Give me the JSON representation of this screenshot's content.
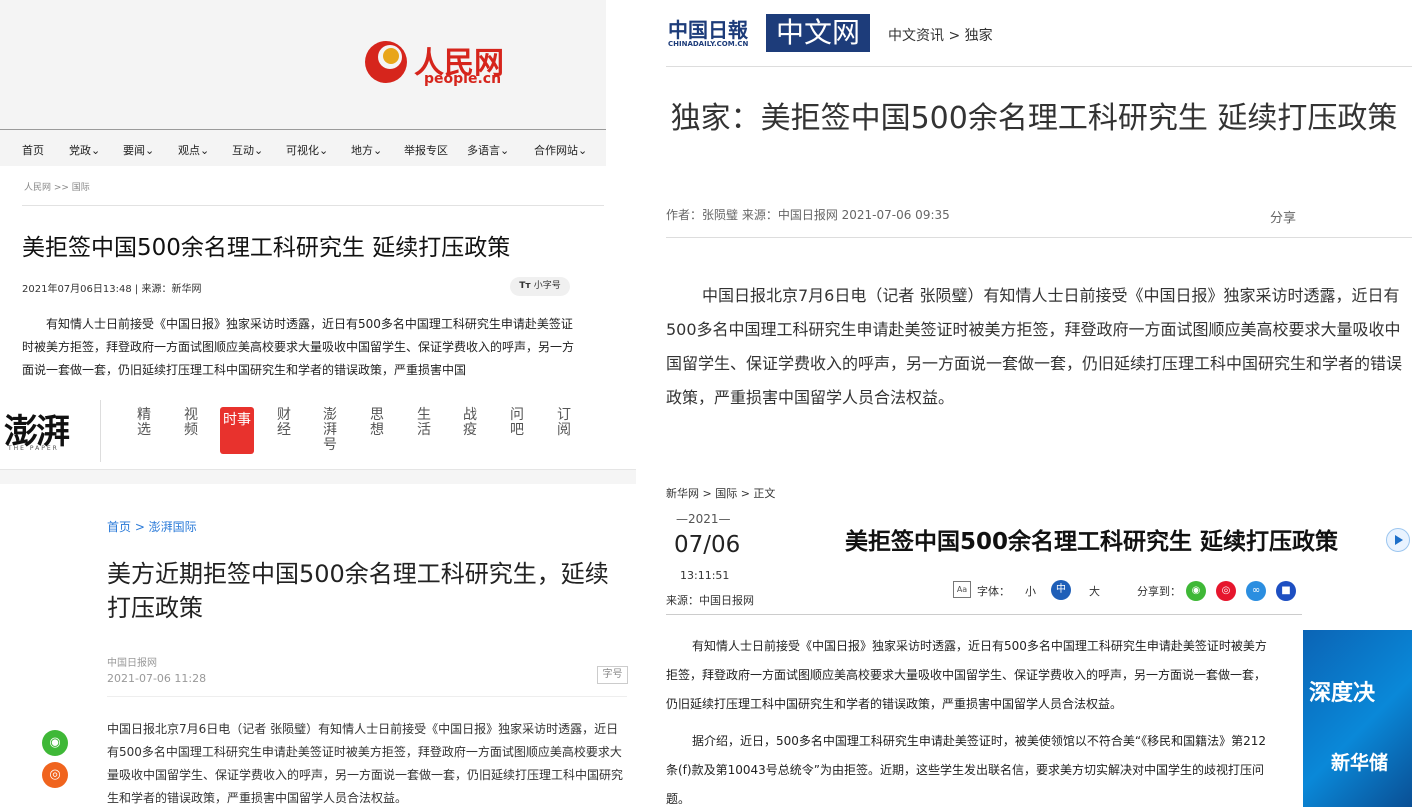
{
  "people": {
    "logo_text": "人民网",
    "logo_url_text": "people.cn",
    "nav": [
      "首页",
      "党政",
      "要闻",
      "观点",
      "互动",
      "可视化",
      "地方",
      "举报专区",
      "多语言",
      "合作网站"
    ],
    "breadcrumb": "人民网 >> 国际",
    "title": "美拒签中国500余名理工科研究生 延续打压政策",
    "meta": "2021年07月06日13:48 | 来源：新华网",
    "font_button": "小字号",
    "body": "有知情人士日前接受《中国日报》独家采访时透露，近日有500多名中国理工科研究生申请赴美签证时被美方拒签，拜登政府一方面试图顺应美高校要求大量吸收中国留学生、保证学费收入的呼声，另一方面说一套做一套，仍旧延续打压理工科中国研究生和学者的错误政策，严重损害中国"
  },
  "paper": {
    "logo_text": "澎湃",
    "logo_sub": "THE PAPER",
    "nav": [
      "精选",
      "视频",
      "时事",
      "财经",
      "澎湃号",
      "思想",
      "生活",
      "战疫",
      "问吧",
      "订阅"
    ],
    "active_nav": "时事",
    "breadcrumb": "首页 > 澎湃国际",
    "title": "美方近期拒签中国500余名理工科研究生，延续打压政策",
    "source": "中国日报网",
    "date": "2021-07-06 11:28",
    "font_button": "字号",
    "body": "中国日报北京7月6日电（记者 张陨璧）有知情人士日前接受《中国日报》独家采访时透露，近日有500多名中国理工科研究生申请赴美签证时被美方拒签，拜登政府一方面试图顺应美高校要求大量吸收中国留学生、保证学费收入的呼声，另一方面说一套做一套，仍旧延续打压理工科中国研究生和学者的错误政策，严重损害中国留学人员合法权益。"
  },
  "chinadaily": {
    "logo_cn": "中国日報",
    "logo_url": "CHINADAILY.COM.CN",
    "logo_box": "中文网",
    "breadcrumb": "中文资讯 > 独家",
    "title": "独家：美拒签中国500余名理工科研究生 延续打压政策",
    "meta": "作者：张陨璧 来源：中国日报网 2021-07-06 09:35",
    "share": "分享",
    "body": "中国日报北京7月6日电（记者 张陨璧）有知情人士日前接受《中国日报》独家采访时透露，近日有500多名中国理工科研究生申请赴美签证时被美方拒签，拜登政府一方面试图顺应美高校要求大量吸收中国留学生、保证学费收入的呼声，另一方面说一套做一套，仍旧延续打压理工科中国研究生和学者的错误政策，严重损害中国留学人员合法权益。"
  },
  "xinhua": {
    "breadcrumb": "新华网 > 国际 > 正文",
    "year": "2021",
    "month_day": "07/06",
    "time": "13:11:51",
    "source": "来源：中国日报网",
    "title": "美拒签中国500余名理工科研究生 延续打压政策",
    "font_label": "字体：",
    "font_small": "小",
    "font_mid": "中",
    "font_large": "大",
    "share_label": "分享到：",
    "para1": "有知情人士日前接受《中国日报》独家采访时透露，近日有500多名中国理工科研究生申请赴美签证时被美方拒签，拜登政府一方面试图顺应美高校要求大量吸收中国留学生、保证学费收入的呼声，另一方面说一套做一套，仍旧延续打压理工科中国研究生和学者的错误政策，严重损害中国留学人员合法权益。",
    "para2": "据介绍，近日，500多名中国理工科研究生申请赴美签证时，被美使领馆以不符合美“《移民和国籍法》第212条(f)款及第10043号总统令”为由拒签。近期，这些学生发出联名信，要求美方切实解决对中国学生的歧视打压问题。",
    "ad_text1": "深度决",
    "ad_text2": "新华储"
  },
  "colors": {
    "paper_red": "#e8322d",
    "people_red": "#d6251c",
    "cd_blue": "#1d3c7a",
    "xinhua_blue": "#1d6fc9"
  }
}
